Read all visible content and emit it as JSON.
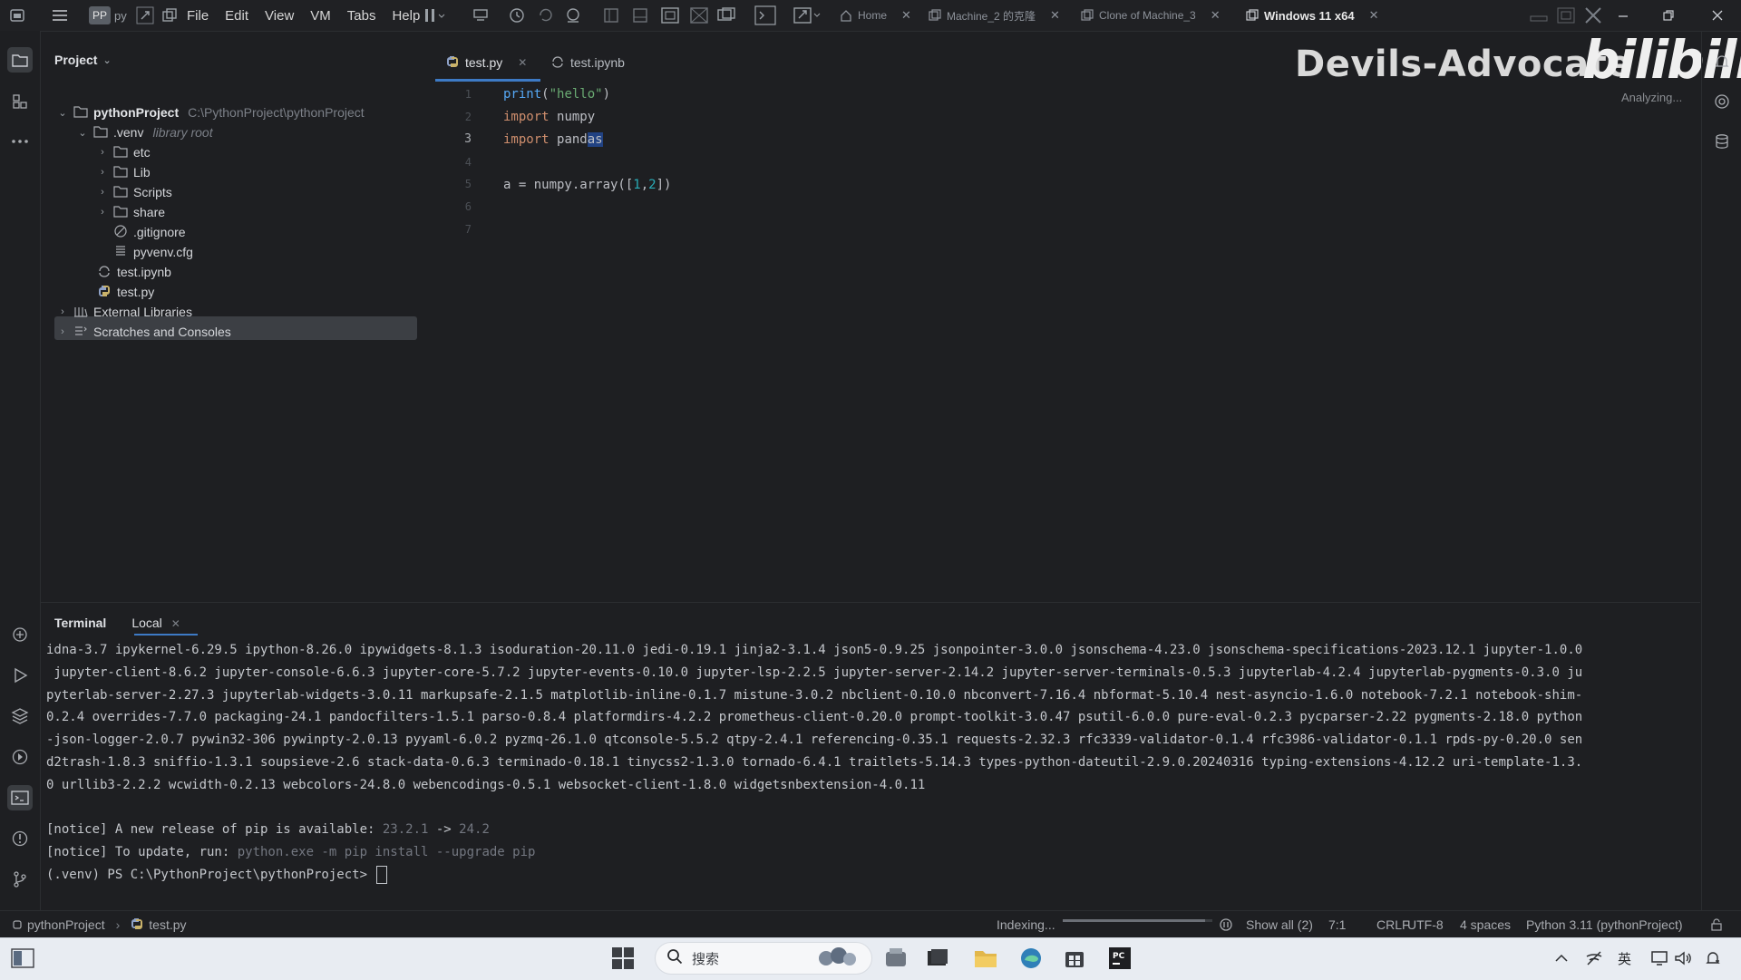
{
  "vm_menu": [
    "File",
    "Edit",
    "View",
    "VM",
    "Tabs",
    "Help"
  ],
  "vm_user": {
    "initials": "PP",
    "name": "py"
  },
  "vm_tabs": [
    {
      "label": "Home"
    },
    {
      "label": "Machine_2 的克隆"
    },
    {
      "label": "Clone of Machine_3"
    },
    {
      "label": "Windows 11 x64"
    }
  ],
  "project": {
    "title": "Project",
    "root_name": "pythonProject",
    "root_path": "C:\\PythonProject\\pythonProject",
    "venv_name": ".venv",
    "venv_note": "library root",
    "venv_items": [
      "etc",
      "Lib",
      "Scripts",
      "share",
      ".gitignore",
      "pyvenv.cfg"
    ],
    "files": [
      "test.ipynb",
      "test.py"
    ],
    "external": "External Libraries",
    "scratches": "Scratches and Consoles"
  },
  "editor": {
    "tabs": [
      "test.py",
      "test.ipynb"
    ],
    "line_numbers": [
      "1",
      "2",
      "3",
      "4",
      "5",
      "6",
      "7"
    ],
    "code": {
      "l1_fn": "print",
      "l1_open": "(",
      "l1_str": "\"hello\"",
      "l1_close": ")",
      "kw_import": "import",
      "l2_mod": "numpy",
      "l3_mod_a": "pand",
      "l3_mod_b": "as",
      "l5_a": "a = numpy.array([",
      "l5_n1": "1",
      "l5_comma": ",",
      "l5_n2": "2",
      "l5_end": "])"
    }
  },
  "watermark": {
    "name": "Devils-Advocate",
    "logo": "bilibili",
    "sub": "Analyzing..."
  },
  "terminal": {
    "tabs": [
      "Terminal",
      "Local"
    ],
    "lines": [
      "idna-3.7 ipykernel-6.29.5 ipython-8.26.0 ipywidgets-8.1.3 isoduration-20.11.0 jedi-0.19.1 jinja2-3.1.4 json5-0.9.25 jsonpointer-3.0.0 jsonschema-4.23.0 jsonschema-specifications-2023.12.1 jupyter-1.0.0",
      " jupyter-client-8.6.2 jupyter-console-6.6.3 jupyter-core-5.7.2 jupyter-events-0.10.0 jupyter-lsp-2.2.5 jupyter-server-2.14.2 jupyter-server-terminals-0.5.3 jupyterlab-4.2.4 jupyterlab-pygments-0.3.0 ju",
      "pyterlab-server-2.27.3 jupyterlab-widgets-3.0.11 markupsafe-2.1.5 matplotlib-inline-0.1.7 mistune-3.0.2 nbclient-0.10.0 nbconvert-7.16.4 nbformat-5.10.4 nest-asyncio-1.6.0 notebook-7.2.1 notebook-shim-",
      "0.2.4 overrides-7.7.0 packaging-24.1 pandocfilters-1.5.1 parso-0.8.4 platformdirs-4.2.2 prometheus-client-0.20.0 prompt-toolkit-3.0.47 psutil-6.0.0 pure-eval-0.2.3 pycparser-2.22 pygments-2.18.0 python",
      "-json-logger-2.0.7 pywin32-306 pywinpty-2.0.13 pyyaml-6.0.2 pyzmq-26.1.0 qtconsole-5.5.2 qtpy-2.4.1 referencing-0.35.1 requests-2.32.3 rfc3339-validator-0.1.4 rfc3986-validator-0.1.1 rpds-py-0.20.0 sen",
      "d2trash-1.8.3 sniffio-1.3.1 soupsieve-2.6 stack-data-0.6.3 terminado-0.18.1 tinycss2-1.3.0 tornado-6.4.1 traitlets-5.14.3 types-python-dateutil-2.9.0.20240316 typing-extensions-4.12.2 uri-template-1.3.",
      "0 urllib3-2.2.2 wcwidth-0.2.13 webcolors-24.8.0 webencodings-0.5.1 websocket-client-1.8.0 widgetsnbextension-4.0.11"
    ],
    "notice1_prefix": "[notice] A new release of pip is available: ",
    "notice1_old": "23.2.1",
    "notice1_arrow": " -> ",
    "notice1_new": "24.2",
    "notice2_prefix": "[notice] To update, run: ",
    "notice2_cmd": "python.exe -m pip install --upgrade pip",
    "prompt": "(.venv) PS C:\\PythonProject\\pythonProject> "
  },
  "status": {
    "crumb_project": "pythonProject",
    "crumb_file": "test.py",
    "indexing": "Indexing...",
    "indexing_progress": 0.95,
    "show_all": "Show all (2)",
    "position": "7:1",
    "line_sep": "CRLF",
    "encoding": "UTF-8",
    "indent": "4 spaces",
    "interpreter": "Python 3.11 (pythonProject)"
  },
  "taskbar": {
    "search_placeholder": "搜索",
    "ime": "英"
  },
  "colors": {
    "accent": "#3d7ac5",
    "background": "#1e1f22",
    "keyword": "#cf8e6d",
    "string": "#6aab73",
    "number": "#2aacb8"
  }
}
